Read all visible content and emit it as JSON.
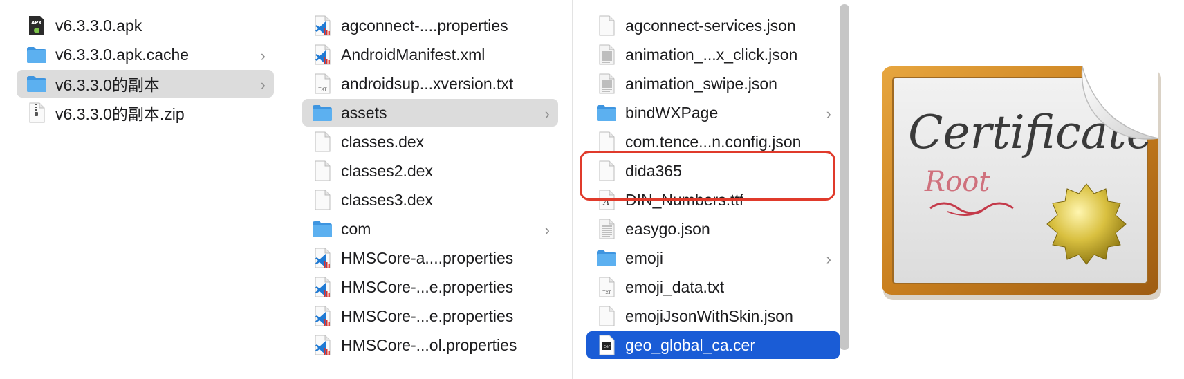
{
  "columns": {
    "col1": [
      {
        "label": "v6.3.3.0.apk",
        "icon": "apk-icon",
        "state": "normal",
        "folder": false
      },
      {
        "label": "v6.3.3.0.apk.cache",
        "icon": "folder-icon",
        "state": "normal",
        "folder": true
      },
      {
        "label": "v6.3.3.0的副本",
        "icon": "folder-icon",
        "state": "selected",
        "folder": true
      },
      {
        "label": "v6.3.3.0的副本.zip",
        "icon": "zip-icon",
        "state": "normal",
        "folder": false
      }
    ],
    "col2": [
      {
        "label": "agconnect-....properties",
        "icon": "vscode-file-icon",
        "state": "normal",
        "folder": false
      },
      {
        "label": "AndroidManifest.xml",
        "icon": "vscode-file-icon",
        "state": "normal",
        "folder": false
      },
      {
        "label": "androidsup...xversion.txt",
        "icon": "txt-file-icon",
        "state": "normal",
        "folder": false
      },
      {
        "label": "assets",
        "icon": "folder-icon",
        "state": "selected",
        "folder": true
      },
      {
        "label": "classes.dex",
        "icon": "blank-file-icon",
        "state": "normal",
        "folder": false
      },
      {
        "label": "classes2.dex",
        "icon": "blank-file-icon",
        "state": "normal",
        "folder": false
      },
      {
        "label": "classes3.dex",
        "icon": "blank-file-icon",
        "state": "normal",
        "folder": false
      },
      {
        "label": "com",
        "icon": "folder-icon",
        "state": "normal",
        "folder": true
      },
      {
        "label": "HMSCore-a....properties",
        "icon": "vscode-file-icon",
        "state": "normal",
        "folder": false
      },
      {
        "label": "HMSCore-...e.properties",
        "icon": "vscode-file-icon",
        "state": "normal",
        "folder": false
      },
      {
        "label": "HMSCore-...e.properties",
        "icon": "vscode-file-icon",
        "state": "normal",
        "folder": false
      },
      {
        "label": "HMSCore-...ol.properties",
        "icon": "vscode-file-icon",
        "state": "normal",
        "folder": false
      }
    ],
    "col3": [
      {
        "label": "agconnect-services.json",
        "icon": "blank-file-icon",
        "state": "normal",
        "folder": false
      },
      {
        "label": "animation_...x_click.json",
        "icon": "text-file-icon",
        "state": "normal",
        "folder": false
      },
      {
        "label": "animation_swipe.json",
        "icon": "text-file-icon",
        "state": "normal",
        "folder": false
      },
      {
        "label": "bindWXPage",
        "icon": "folder-icon",
        "state": "normal",
        "folder": true
      },
      {
        "label": "com.tence...n.config.json",
        "icon": "blank-file-icon",
        "state": "normal",
        "folder": false
      },
      {
        "label": "dida365",
        "icon": "blank-file-icon",
        "state": "normal",
        "folder": false
      },
      {
        "label": "DIN_Numbers.ttf",
        "icon": "font-file-icon",
        "state": "normal",
        "folder": false
      },
      {
        "label": "easygo.json",
        "icon": "text-file-icon",
        "state": "normal",
        "folder": false
      },
      {
        "label": "emoji",
        "icon": "folder-icon",
        "state": "normal",
        "folder": true
      },
      {
        "label": "emoji_data.txt",
        "icon": "txt-file-icon",
        "state": "normal",
        "folder": false
      },
      {
        "label": "emojiJsonWithSkin.json",
        "icon": "blank-file-icon",
        "state": "normal",
        "folder": false
      },
      {
        "label": "geo_global_ca.cer",
        "icon": "cert-file-icon",
        "state": "active",
        "folder": false
      }
    ]
  },
  "preview": {
    "icon": "certificate-icon",
    "script_text": "Certificate",
    "sub_text": "Root"
  },
  "colors": {
    "selection_gray": "#dcdcdc",
    "selection_blue": "#1a5cd6",
    "folder_blue": "#4aa3ea",
    "annotation_red": "#e03a2b"
  }
}
